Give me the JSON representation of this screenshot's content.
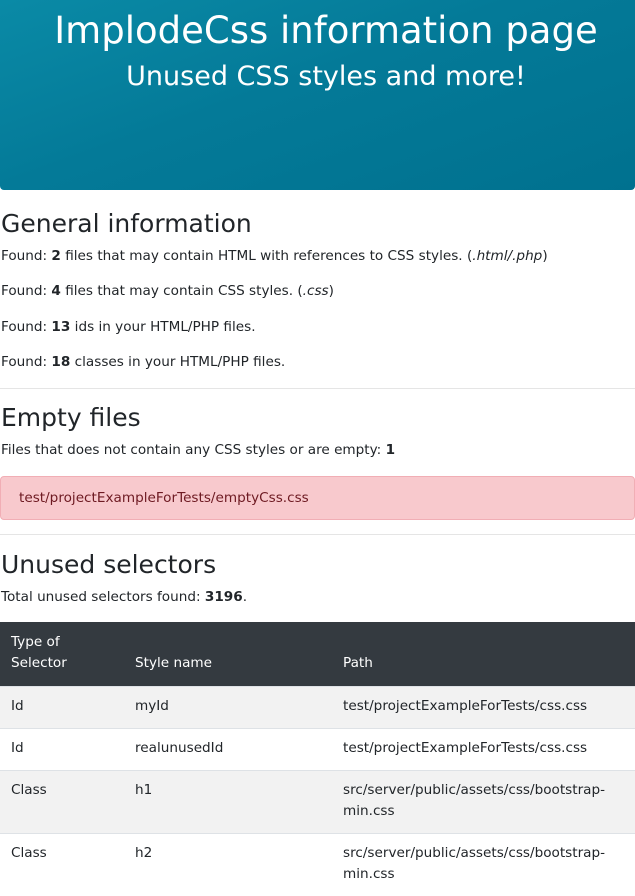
{
  "hero": {
    "title": "ImplodeCss information page",
    "subtitle": "Unused CSS styles and more!"
  },
  "general": {
    "heading": "General information",
    "lines": [
      {
        "prefix": "Found: ",
        "count": "2",
        "text": " files that may contain HTML with references to CSS styles. (",
        "ext": ".html/.php",
        "suffix": ")"
      },
      {
        "prefix": "Found: ",
        "count": "4",
        "text": " files that may contain CSS styles. (",
        "ext": ".css",
        "suffix": ")"
      },
      {
        "prefix": "Found: ",
        "count": "13",
        "text": " ids in your HTML/PHP files.",
        "ext": "",
        "suffix": ""
      },
      {
        "prefix": "Found: ",
        "count": "18",
        "text": " classes in your HTML/PHP files.",
        "ext": "",
        "suffix": ""
      }
    ]
  },
  "empty_files": {
    "heading": "Empty files",
    "description": "Files that does not contain any CSS styles or are empty: ",
    "count": "1",
    "items": [
      "test/projectExampleForTests/emptyCss.css"
    ]
  },
  "unused": {
    "heading": "Unused selectors",
    "description": "Total unused selectors found: ",
    "count": "3196",
    "suffix": ".",
    "columns": {
      "type_line1": "Type of",
      "type_line2": "Selector",
      "style": "Style name",
      "path": "Path"
    },
    "rows": [
      {
        "type": "Id",
        "style": "myId",
        "path1": "test/projectExampleForTests/css.css",
        "path2": ""
      },
      {
        "type": "Id",
        "style": "realunusedId",
        "path1": "test/projectExampleForTests/css.css",
        "path2": ""
      },
      {
        "type": "Class",
        "style": "h1",
        "path1": "src/server/public/assets/css/bootstrap-",
        "path2": "min.css"
      },
      {
        "type": "Class",
        "style": "h2",
        "path1": "src/server/public/assets/css/bootstrap-",
        "path2": "min.css"
      }
    ]
  },
  "colors": {
    "hero_bg": "#047a98",
    "table_head_bg": "#343a40",
    "alert_bg": "#f8c9cd",
    "alert_text": "#6e1a22"
  }
}
